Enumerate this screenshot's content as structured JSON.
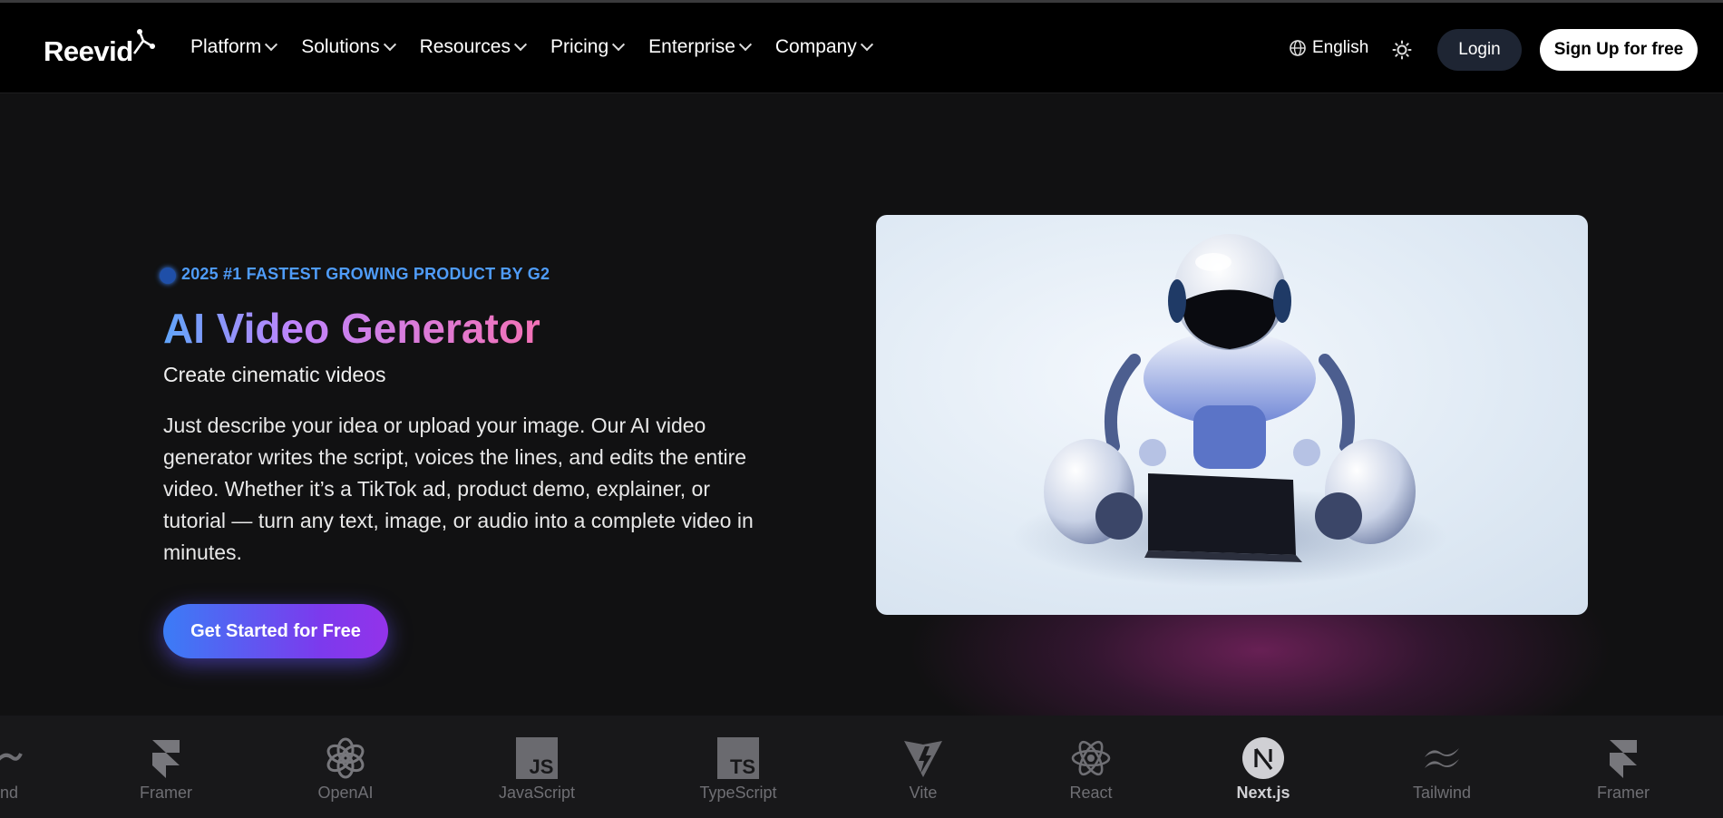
{
  "nav": {
    "logo_text": "Reevid",
    "menu": [
      {
        "label": "Platform"
      },
      {
        "label": "Solutions"
      },
      {
        "label": "Resources"
      },
      {
        "label": "Pricing"
      },
      {
        "label": "Enterprise"
      },
      {
        "label": "Company"
      }
    ],
    "language": "English",
    "login_label": "Login",
    "signup_label": "Sign Up for free"
  },
  "hero": {
    "badge": "2025 #1 FASTEST GROWING PRODUCT BY G2",
    "title": "AI Video Generator",
    "subtitle": "Create cinematic videos",
    "description": "Just describe your idea or upload your image. Our AI video generator writes the script, voices the lines, and edits the entire video. Whether it’s a TikTok ad, product demo, explainer, or tutorial — turn any text, image, or audio into a complete video in minutes.",
    "cta_label": "Get Started for Free"
  },
  "tech_logos": [
    {
      "label": "nd",
      "icon": "tailwind-icon"
    },
    {
      "label": "Framer",
      "icon": "framer-icon"
    },
    {
      "label": "OpenAI",
      "icon": "openai-icon"
    },
    {
      "label": "JavaScript",
      "icon": "javascript-icon"
    },
    {
      "label": "TypeScript",
      "icon": "typescript-icon"
    },
    {
      "label": "Vite",
      "icon": "vite-icon"
    },
    {
      "label": "React",
      "icon": "react-icon"
    },
    {
      "label": "Next.js",
      "icon": "nextjs-icon"
    },
    {
      "label": "Tailwind",
      "icon": "tailwind-icon"
    },
    {
      "label": "Framer",
      "icon": "framer-icon"
    }
  ],
  "colors": {
    "badge": "#4f9cf9",
    "title_gradient": [
      "#60a5fa",
      "#c084fc",
      "#f472b6"
    ],
    "cta_gradient": [
      "#3b7cf6",
      "#9333ea"
    ],
    "login_bg": "#1e2533"
  }
}
